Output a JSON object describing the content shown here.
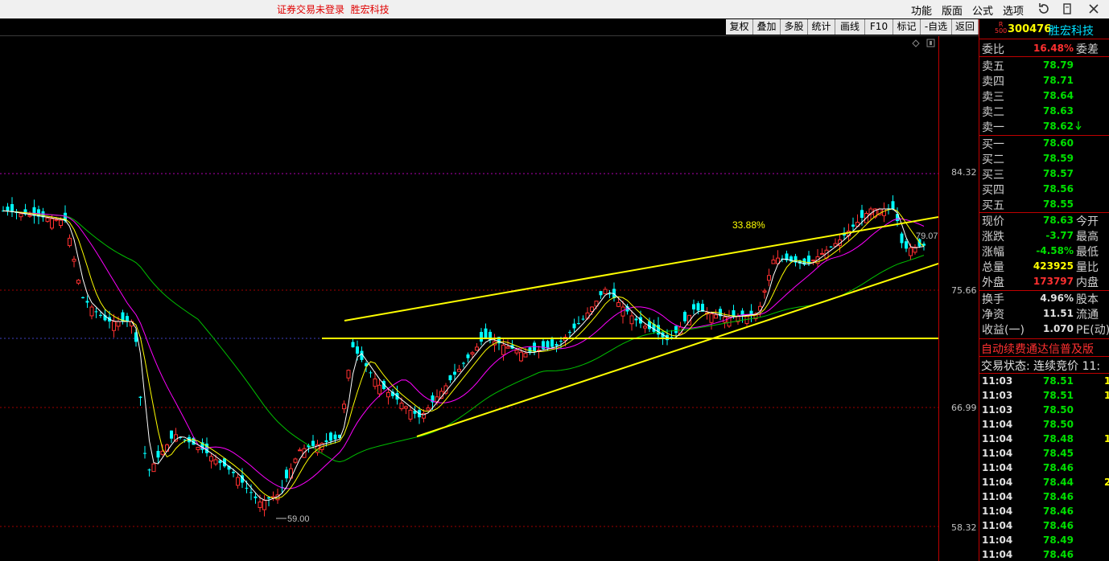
{
  "title_bar": {
    "status": "证券交易未登录",
    "stock_name": "胜宏科技",
    "menus": [
      "功能",
      "版面",
      "公式",
      "选项"
    ]
  },
  "toolbar": [
    "复权",
    "叠加",
    "多股",
    "统计",
    "画线",
    "F10",
    "标记",
    "-自选",
    "返回"
  ],
  "price_axis": [
    "84.32",
    "75.66",
    "66.99",
    "58.32"
  ],
  "annotations": {
    "percent": "33.88%",
    "low_label": "59.00",
    "last_label": "79.07"
  },
  "panel": {
    "badge_top": "R",
    "badge_bottom": "500",
    "code": "300476",
    "name": "胜宏科技",
    "weibi_label": "委比",
    "weibi_value": "16.48%",
    "weicha_label": "委差",
    "asks": [
      {
        "label": "卖五",
        "price": "78.79"
      },
      {
        "label": "卖四",
        "price": "78.71"
      },
      {
        "label": "卖三",
        "price": "78.64"
      },
      {
        "label": "卖二",
        "price": "78.63"
      },
      {
        "label": "卖一",
        "price": "78.62"
      }
    ],
    "bids": [
      {
        "label": "买一",
        "price": "78.60"
      },
      {
        "label": "买二",
        "price": "78.59"
      },
      {
        "label": "买三",
        "price": "78.57"
      },
      {
        "label": "买四",
        "price": "78.56"
      },
      {
        "label": "买五",
        "price": "78.55"
      }
    ],
    "stats": [
      {
        "label": "现价",
        "value": "78.63",
        "right": "今开"
      },
      {
        "label": "涨跌",
        "value": "-3.77",
        "right": "最高"
      },
      {
        "label": "涨幅",
        "value": "-4.58%",
        "right": "最低"
      },
      {
        "label": "总量",
        "value": "423925",
        "right": "量比"
      },
      {
        "label": "外盘",
        "value": "173797",
        "right": "内盘"
      }
    ],
    "stats2": [
      {
        "label": "换手",
        "value": "4.96%",
        "right": "股本"
      },
      {
        "label": "净资",
        "value": "11.51",
        "right": "流通"
      },
      {
        "label": "收益(一)",
        "value": "1.070",
        "right": "PE(动)"
      }
    ],
    "ad_text": "自动续费通达信普及版",
    "trade_status": "交易状态: 连续竞价 11:",
    "ticks": [
      {
        "time": "11:03",
        "price": "78.51",
        "extra": "1"
      },
      {
        "time": "11:03",
        "price": "78.51",
        "extra": "1"
      },
      {
        "time": "11:03",
        "price": "78.50",
        "extra": ""
      },
      {
        "time": "11:04",
        "price": "78.50",
        "extra": ""
      },
      {
        "time": "11:04",
        "price": "78.48",
        "extra": "1"
      },
      {
        "time": "11:04",
        "price": "78.45",
        "extra": ""
      },
      {
        "time": "11:04",
        "price": "78.46",
        "extra": ""
      },
      {
        "time": "11:04",
        "price": "78.44",
        "extra": "2"
      },
      {
        "time": "11:04",
        "price": "78.46",
        "extra": ""
      },
      {
        "time": "11:04",
        "price": "78.46",
        "extra": ""
      },
      {
        "time": "11:04",
        "price": "78.46",
        "extra": ""
      },
      {
        "time": "11:04",
        "price": "78.49",
        "extra": ""
      },
      {
        "time": "11:04",
        "price": "78.46",
        "extra": ""
      }
    ]
  },
  "colors": {
    "up": "#ff3030",
    "down": "#00ffff",
    "ma5": "#ffffff",
    "ma10": "#ffff00",
    "ma20": "#ff00ff",
    "ma60": "#00c000",
    "trend": "#ffff00"
  }
}
